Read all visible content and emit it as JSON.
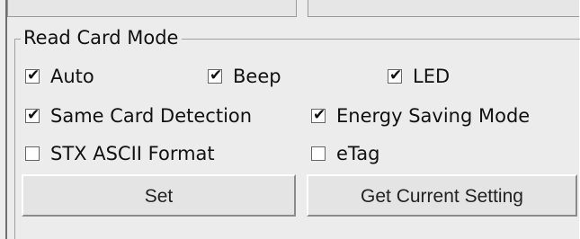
{
  "group": {
    "title": "Read Card Mode"
  },
  "options": [
    {
      "label": "Auto",
      "checked": true
    },
    {
      "label": "Beep",
      "checked": true
    },
    {
      "label": "LED",
      "checked": true
    },
    {
      "label": "Same Card Detection",
      "checked": true
    },
    {
      "label": "Energy Saving Mode",
      "checked": true
    },
    {
      "label": "STX ASCII Format",
      "checked": false
    },
    {
      "label": "eTag",
      "checked": false
    }
  ],
  "buttons": {
    "set_label": "Set",
    "get_current_setting_label": "Get Current Setting"
  },
  "icons": {
    "checkbox_checked": "check-mark-icon"
  }
}
